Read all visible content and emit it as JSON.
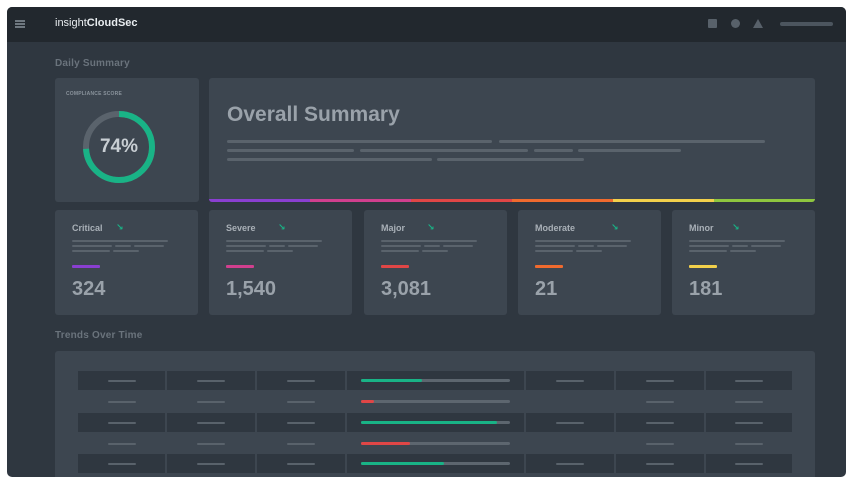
{
  "header": {
    "brand_prefix": "insight",
    "brand_bold": "CloudSec"
  },
  "daily_summary": {
    "title": "Daily Summary",
    "compliance": {
      "label": "COMPLIANCE SCORE",
      "value_text": "74%",
      "value": 74
    },
    "overall": {
      "title": "Overall Summary"
    }
  },
  "severity_cards": [
    {
      "name": "Critical",
      "count": "324",
      "color": "#8a3fd1"
    },
    {
      "name": "Severe",
      "count": "1,540",
      "color": "#d13f8e"
    },
    {
      "name": "Major",
      "count": "3,081",
      "color": "#e04646"
    },
    {
      "name": "Moderate",
      "count": "21",
      "color": "#f06a2e"
    },
    {
      "name": "Minor",
      "count": "181",
      "color": "#f2d04b"
    }
  ],
  "severity_strip_colors": [
    "#8a3fd1",
    "#d13f8e",
    "#e04646",
    "#f06a2e",
    "#f2d04b",
    "#8ec63f"
  ],
  "trend_arrow_icon": "arrow-down-right-icon",
  "trends": {
    "title": "Trends Over Time",
    "rows": [
      {
        "shaded": true,
        "progress": 0.41,
        "bar_color": "#19b386",
        "col5": true
      },
      {
        "shaded": false,
        "progress": 0.09,
        "bar_color": "#e04646",
        "col5": false
      },
      {
        "shaded": true,
        "progress": 0.91,
        "bar_color": "#19b386",
        "col5": true
      },
      {
        "shaded": false,
        "progress": 0.33,
        "bar_color": "#e04646",
        "col5": false
      },
      {
        "shaded": true,
        "progress": 0.56,
        "bar_color": "#19b386",
        "col5": true
      }
    ]
  },
  "colors": {
    "accent": "#19b386",
    "gauge_track": "#5a636c"
  }
}
